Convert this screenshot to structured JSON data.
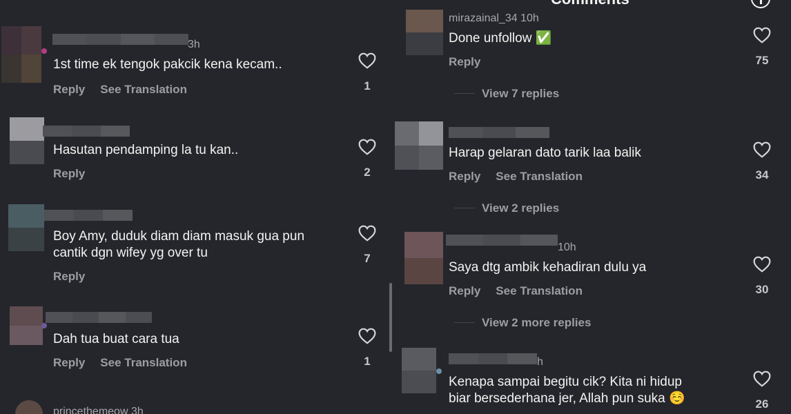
{
  "header": {
    "title": "Comments"
  },
  "actions": {
    "reply": "Reply",
    "see_translation": "See Translation"
  },
  "left_comments": [
    {
      "time": "3h",
      "text": [
        "1st time ek tengok pakcik kena kecam.."
      ],
      "likes": "1",
      "translation": true
    },
    {
      "time": "",
      "text": [
        "Hasutan pendamping la tu kan.."
      ],
      "likes": "2",
      "translation": false
    },
    {
      "time": "",
      "text": [
        "Boy Amy, duduk diam diam masuk gua pun",
        "cantik dgn wifey yg over tu"
      ],
      "likes": "7",
      "translation": false
    },
    {
      "time": "",
      "text": [
        "Dah tua buat cara tua"
      ],
      "likes": "1",
      "translation": true
    }
  ],
  "left_bottom_cut_name": "princethemeow 3h",
  "right_top_cut_name": "mirazainal_34 10h",
  "right_comments": [
    {
      "time": "",
      "text": [
        "Done unfollow ✅"
      ],
      "likes": "75",
      "translation": false,
      "replies": "View 7 replies"
    },
    {
      "time": "",
      "text": [
        "Harap gelaran dato tarik laa balik"
      ],
      "likes": "34",
      "translation": true,
      "replies": "View 2 replies"
    },
    {
      "time": "10h",
      "text": [
        "Saya dtg ambik kehadiran dulu ya"
      ],
      "likes": "30",
      "translation": true,
      "replies": "View 2 more replies"
    },
    {
      "time": "h",
      "text": [
        "Kenapa sampai begitu cik? Kita ni hidup",
        "biar bersederhana jer, Allah pun suka ☺️"
      ],
      "likes": "26",
      "translation": false,
      "replies": ""
    }
  ],
  "colors": {
    "background": "#25262b",
    "secondary_text": "#9d9ea3",
    "primary_text": "#f3f3f3"
  },
  "icons": {
    "like": "heart-icon",
    "info": "info-icon"
  }
}
